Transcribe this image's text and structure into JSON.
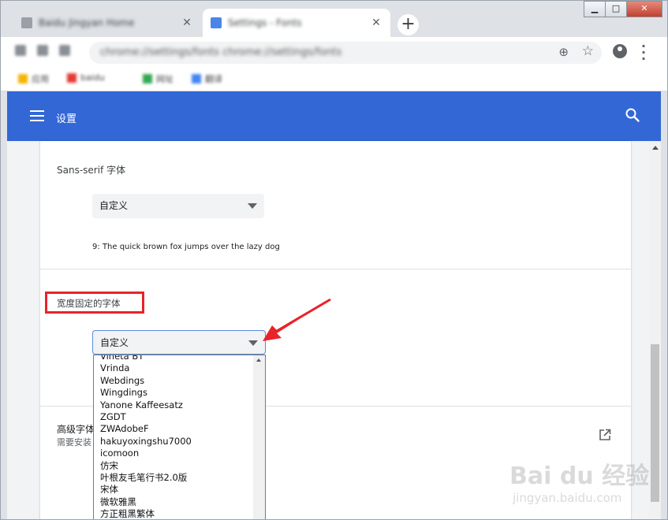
{
  "browser": {
    "tabs": [
      {
        "title": "Baidu Jingyan Home",
        "favicon_color": "#9aa0a6",
        "active": false
      },
      {
        "title": "Settings - Fonts",
        "favicon_color": "#4a86e8",
        "active": true
      }
    ],
    "tab_close_glyph": "✕",
    "new_tab_glyph": "+",
    "window_controls": {
      "minimize": "▁",
      "maximize": "□",
      "close": "✕"
    },
    "url": "chrome://settings/fonts  chrome://settings/fonts",
    "bookmarks": [
      {
        "label": "应用",
        "color": "#f4b400"
      },
      {
        "label": "baidu",
        "color": "#e53935"
      },
      {
        "label": "网址",
        "color": "#34a853"
      },
      {
        "label": "翻译",
        "color": "#4285f4"
      }
    ]
  },
  "app": {
    "title": "设置",
    "accent": "#3367d6"
  },
  "fonts": {
    "sans_serif": {
      "label": "Sans-serif 字体",
      "selected": "自定义",
      "sample": "9: The quick brown fox jumps over the lazy dog"
    },
    "fixed_width": {
      "label": "宽度固定的字体",
      "selected": "自定义",
      "options": [
        "Vineta BT",
        "Vrinda",
        "Webdings",
        "Wingdings",
        "Yanone Kaffeesatz",
        "ZGDT",
        "ZWAdobeF",
        "hakuyoxingshu7000",
        "icomoon",
        "仿宋",
        "叶根友毛笔行书2.0版",
        "宋体",
        "微软雅黑",
        "方正粗黑繁体"
      ]
    },
    "advanced": {
      "title": "高级字体",
      "subtitle": "需要安装"
    }
  },
  "annotation_color": "#e8232a",
  "watermark": {
    "logo": "Bai du 经验",
    "url": "jingyan.baidu.com"
  }
}
